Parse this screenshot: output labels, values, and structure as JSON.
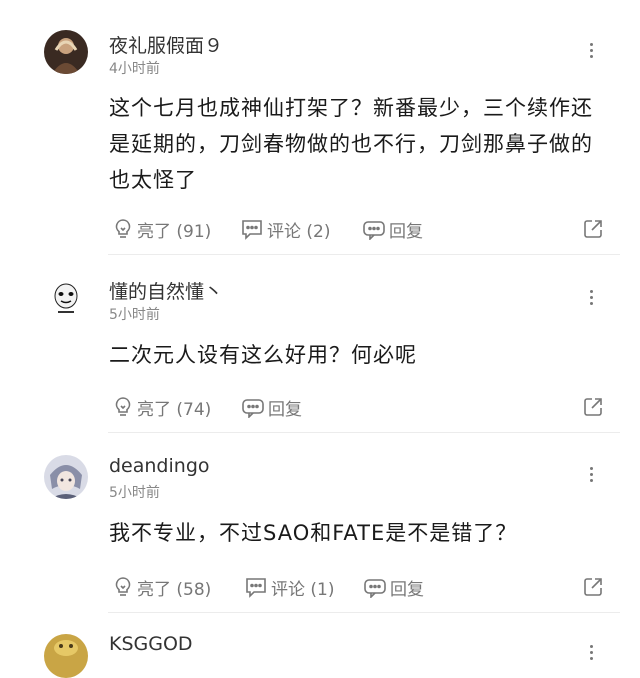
{
  "comments": [
    {
      "username": "夜礼服假面９",
      "time": "4小时前",
      "text": "这个七月也成神仙打架了？新番最少，三个续作还是延期的，刀剑春物做的也不行，刀剑那鼻子做的也太怪了",
      "like_label": "亮了 (91)",
      "comment_label": "评论 (2)",
      "reply_label": "回复"
    },
    {
      "username": "懂的自然懂丶",
      "time": "5小时前",
      "text": "二次元人设有这么好用？何必呢",
      "like_label": "亮了 (74)",
      "reply_label": "回复"
    },
    {
      "username": "deandingo",
      "time": "5小时前",
      "text": "我不专业，不过SAO和FATE是不是错了？",
      "like_label": "亮了 (58)",
      "comment_label": "评论 (1)",
      "reply_label": "回复"
    },
    {
      "username": "KSGGOD"
    }
  ],
  "colors": {
    "text": "#1a1a1a",
    "meta": "#888888",
    "action": "#777777",
    "divider": "#ececec"
  },
  "icons": {
    "like": "lightbulb-icon",
    "comment": "speech-bubble-icon",
    "reply": "reply-bubble-icon",
    "share": "share-icon",
    "more": "more-vertical-icon"
  }
}
